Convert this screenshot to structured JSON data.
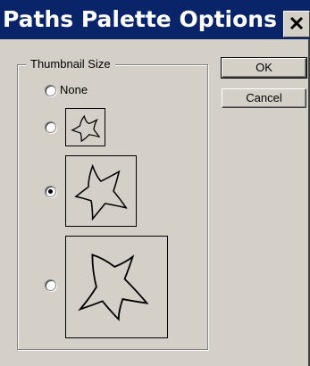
{
  "window": {
    "title": "Paths Palette Options",
    "close_symbol": "✕"
  },
  "thumbnail_size": {
    "legend": "Thumbnail Size",
    "options": [
      {
        "label": "None",
        "selected": false
      },
      {
        "label": "",
        "size": "small",
        "selected": false
      },
      {
        "label": "",
        "size": "medium",
        "selected": true
      },
      {
        "label": "",
        "size": "large",
        "selected": false
      }
    ]
  },
  "buttons": {
    "ok_label": "OK",
    "cancel_label": "Cancel"
  },
  "icons": [
    "close-icon",
    "star-path-thumbnail-icon"
  ],
  "colors": {
    "titlebar": "#0a246a",
    "dialog_background": "#d4d0c8",
    "title_text": "#ffffff"
  }
}
